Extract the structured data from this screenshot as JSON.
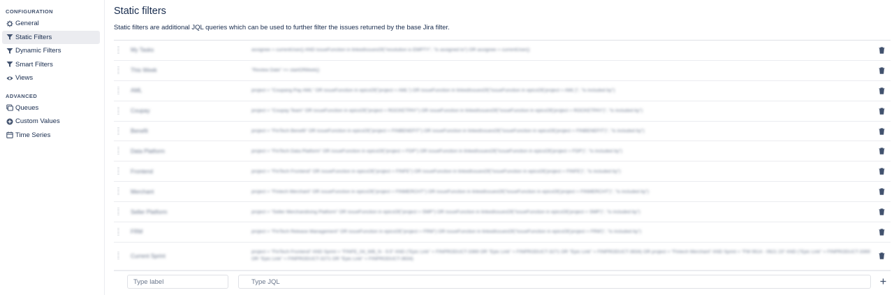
{
  "sidebar": {
    "configuration_title": "CONFIGURATION",
    "advanced_title": "ADVANCED",
    "config_items": [
      {
        "label": "General",
        "icon": "gear-icon"
      },
      {
        "label": "Static Filters",
        "icon": "filter-icon",
        "active": true
      },
      {
        "label": "Dynamic Filters",
        "icon": "filter-icon"
      },
      {
        "label": "Smart Filters",
        "icon": "filter-icon"
      },
      {
        "label": "Views",
        "icon": "eye-icon"
      }
    ],
    "advanced_items": [
      {
        "label": "Queues",
        "icon": "queue-icon"
      },
      {
        "label": "Custom Values",
        "icon": "plus-circle-icon"
      },
      {
        "label": "Time Series",
        "icon": "calendar-icon"
      }
    ]
  },
  "main": {
    "title": "Static filters",
    "description": "Static filters are additional JQL queries which can be used to further filter the issues returned by the base Jira filter.",
    "filters": [
      {
        "label": "My Tasks",
        "jql": "assignee = currentUser() AND issueFunction in linkedIssuesOf(\"resolution is EMPTY\", \"is assigned to\") OR assignee = currentUser()"
      },
      {
        "label": "This Week",
        "jql": "\"Review Date\" >= startOfWeek()"
      },
      {
        "label": "AML",
        "jql": "project = \"Coupang Pay AML\" OR issueFunction in epicsOf(\"project = AML\") OR issueFunction in linkedIssuesOf(\"issueFunction in epicsOf('project = AML')\", \"is included by\")"
      },
      {
        "label": "Coupay",
        "jql": "project = \"Coupay Team\" OR issueFunction in epicsOf(\"project = ROCKETPAY\") OR issueFunction in linkedIssuesOf(\"issueFunction in epicsOf('project = ROCKETPAY')\", \"is included by\")"
      },
      {
        "label": "Benefit",
        "jql": "project = \"FinTech Benefit\" OR issueFunction in epicsOf(\"project = FINBENEFIT\") OR issueFunction in linkedIssuesOf(\"issueFunction in epicsOf('project = FINBENEFIT')\", \"is included by\")"
      },
      {
        "label": "Data Platform",
        "jql": "project = \"FinTech Data Platform\" OR issueFunction in epicsOf(\"project = FDP\") OR issueFunction in linkedIssuesOf(\"issueFunction in epicsOf('project = FDP')\", \"is included by\")"
      },
      {
        "label": "Frontend",
        "jql": "project = \"FinTech Frontend\" OR issueFunction in epicsOf(\"project = FINFE\") OR issueFunction in linkedIssuesOf(\"issueFunction in epicsOf('project = FINFE')\", \"is included by\")"
      },
      {
        "label": "Merchant",
        "jql": "project = \"Fintech Merchant\" OR issueFunction in epicsOf(\"project = FINMERCHT\") OR issueFunction in linkedIssuesOf(\"issueFunction in epicsOf('project = FINMERCHT')\", \"is included by\")"
      },
      {
        "label": "Seller Platform",
        "jql": "project = \"Seller Merchandising Platform\" OR issueFunction in epicsOf(\"project = SMP\") OR issueFunction in linkedIssuesOf(\"issueFunction in epicsOf('project = SMP')\", \"is included by\")"
      },
      {
        "label": "FRM",
        "jql": "project = \"FinTech Release Management\" OR issueFunction in epicsOf(\"project = FRM\") OR issueFunction in linkedIssuesOf(\"issueFunction in epicsOf('project = FRM')\", \"is included by\")"
      },
      {
        "label": "Current Sprint",
        "jql": "project = \"FinTech Frontend\" AND Sprint = \"FINFE_04_WB_N - 9.5\" AND (\"Epic Link\" = FINPRODUCT-3369 OR \"Epic Link\" = FINPRODUCT-3271 OR \"Epic Link\" = FINPRODUCT-3634) OR project = \"Fintech Merchant\" AND Sprint = \"FM 0614 - 0621 23\" AND (\"Epic Link\" = FINPRODUCT-3369 OR \"Epic Link\" = FINPRODUCT-3271 OR \"Epic Link\" = FINPRODUCT-3634)"
      }
    ],
    "new_label_placeholder": "Type label",
    "new_jql_placeholder": "Type JQL"
  }
}
